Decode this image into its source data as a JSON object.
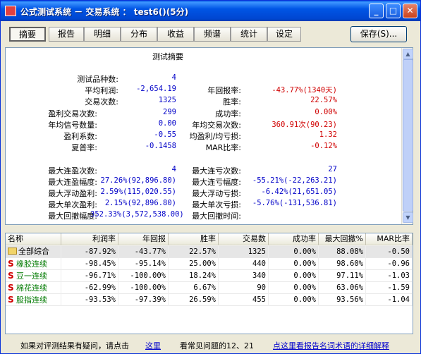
{
  "window": {
    "title": "公式测试系统 － 交易系统 ： test6()(5分)",
    "buttons": {
      "minimize": "_",
      "maximize": "□",
      "close": "✕"
    }
  },
  "tabs": [
    "摘要",
    "报告",
    "明细",
    "分布",
    "收益",
    "频谱",
    "统计",
    "设定"
  ],
  "save_label": "保存(S)...",
  "summary": {
    "title": "测试摘要",
    "left": [
      {
        "label": "测试品种数:",
        "value": "4"
      },
      {
        "label": "平均利润:",
        "value": "-2,654.19"
      },
      {
        "label": "交易次数:",
        "value": "1325"
      },
      {
        "label": "盈利交易次数:",
        "value": "299"
      },
      {
        "label": "年均信号数量:",
        "value": "0.00"
      },
      {
        "label": "盈利系数:",
        "value": "-0.55"
      },
      {
        "label": "夏普率:",
        "value": "-0.1458"
      },
      {
        "label": "最大连盈次数:",
        "value": "4"
      },
      {
        "label": "最大连盈幅度:",
        "value": "27.26%(92,896.80)"
      },
      {
        "label": "最大浮动盈利:",
        "value": "2.59%(115,020.55)"
      },
      {
        "label": "最大单次盈利:",
        "value": "2.15%(92,896.80)"
      },
      {
        "label": "最大回撤幅度:",
        "value": "352.33%(3,572,538.00)"
      }
    ],
    "right": [
      {
        "label": "年回报率:",
        "value": "-43.77%(1340天)"
      },
      {
        "label": "胜率:",
        "value": "22.57%"
      },
      {
        "label": "成功率:",
        "value": "0.00%"
      },
      {
        "label": "年均交易次数:",
        "value": "360.91次(90.23)"
      },
      {
        "label": "均盈利/均亏损:",
        "value": "1.32"
      },
      {
        "label": "MAR比率:",
        "value": "-0.12%"
      },
      {
        "label": "最大连亏次数:",
        "value": "27"
      },
      {
        "label": "最大连亏幅度:",
        "value": "-55.21%(-22,263.21)"
      },
      {
        "label": "最大浮动亏损:",
        "value": "-6.42%(21,651.05)"
      },
      {
        "label": "最大单次亏损:",
        "value": "-5.76%(-131,536.81)"
      },
      {
        "label": "最大回撤时间:",
        "value": ""
      }
    ]
  },
  "table": {
    "headers": [
      "名称",
      "利润率",
      "年回报",
      "胜率",
      "交易数",
      "成功率",
      "最大回撤%",
      "MAR比率"
    ],
    "rows": [
      {
        "name": "全部综合",
        "icon": "folder-icon",
        "cells": [
          "-87.92%",
          "-43.77%",
          "22.57%",
          "1325",
          "0.00%",
          "88.08%",
          "-0.50"
        ]
      },
      {
        "name": "橡胶连续",
        "icon": "s-icon",
        "cells": [
          "-98.45%",
          "-95.14%",
          "25.00%",
          "440",
          "0.00%",
          "98.60%",
          "-0.96"
        ]
      },
      {
        "name": "豆一连续",
        "icon": "s-icon",
        "cells": [
          "-96.71%",
          "-100.00%",
          "18.24%",
          "340",
          "0.00%",
          "97.11%",
          "-1.03"
        ]
      },
      {
        "name": "棉花连续",
        "icon": "s-icon",
        "cells": [
          "-62.99%",
          "-100.00%",
          "6.67%",
          "90",
          "0.00%",
          "63.06%",
          "-1.59"
        ]
      },
      {
        "name": "股指连续",
        "icon": "s-icon",
        "cells": [
          "-93.53%",
          "-97.39%",
          "26.59%",
          "455",
          "0.00%",
          "93.56%",
          "-1.04"
        ]
      }
    ]
  },
  "status": {
    "prefix": "如果对评测结果有疑问，请点击",
    "link1": "这里",
    "middle": "看常见问题的12、21",
    "link2": "点这里看报告名词术语的详细解释"
  },
  "colors": {
    "title_bar": "#0055e5",
    "value_blue": "#0000c8",
    "value_red": "#d00000",
    "name_green": "#007a00"
  }
}
